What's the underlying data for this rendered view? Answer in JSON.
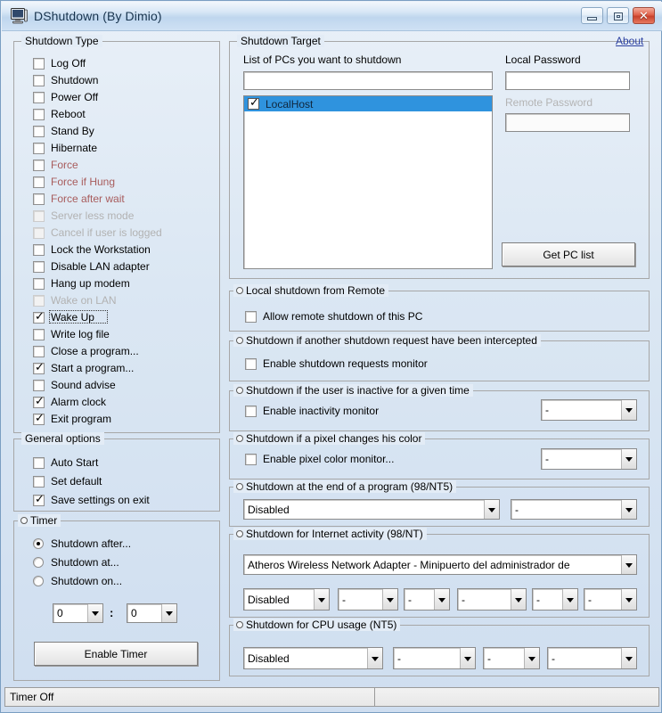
{
  "window": {
    "title": "DShutdown (By Dimio)",
    "icon": "computer-icon",
    "minimize_label": "",
    "maximize_label": "",
    "close_label": "✕"
  },
  "shutdown_type": {
    "title": "Shutdown Type",
    "items": [
      {
        "label": "Log Off",
        "checked": false,
        "state": "normal"
      },
      {
        "label": "Shutdown",
        "checked": false,
        "state": "normal"
      },
      {
        "label": "Power Off",
        "checked": false,
        "state": "normal"
      },
      {
        "label": "Reboot",
        "checked": false,
        "state": "normal"
      },
      {
        "label": "Stand By",
        "checked": false,
        "state": "normal"
      },
      {
        "label": "Hibernate",
        "checked": false,
        "state": "normal"
      },
      {
        "label": "Force",
        "checked": false,
        "state": "red"
      },
      {
        "label": "Force if Hung",
        "checked": false,
        "state": "red"
      },
      {
        "label": "Force after wait",
        "checked": false,
        "state": "red"
      },
      {
        "label": "Server less mode",
        "checked": false,
        "state": "disabled"
      },
      {
        "label": "Cancel if user is logged",
        "checked": false,
        "state": "disabled"
      },
      {
        "label": "Lock the Workstation",
        "checked": false,
        "state": "normal"
      },
      {
        "label": "Disable LAN adapter",
        "checked": false,
        "state": "normal"
      },
      {
        "label": "Hang up modem",
        "checked": false,
        "state": "normal"
      },
      {
        "label": "Wake on LAN",
        "checked": false,
        "state": "disabled"
      },
      {
        "label": "Wake Up",
        "checked": true,
        "state": "focused"
      },
      {
        "label": "Write log file",
        "checked": false,
        "state": "normal"
      },
      {
        "label": "Close a program...",
        "checked": false,
        "state": "normal"
      },
      {
        "label": "Start a program...",
        "checked": true,
        "state": "normal"
      },
      {
        "label": "Sound advise",
        "checked": false,
        "state": "normal"
      },
      {
        "label": "Alarm clock",
        "checked": true,
        "state": "normal"
      },
      {
        "label": "Exit program",
        "checked": true,
        "state": "normal"
      }
    ]
  },
  "general_options": {
    "title": "General options",
    "items": [
      {
        "label": "Auto Start",
        "checked": false
      },
      {
        "label": "Set default",
        "checked": false
      },
      {
        "label": "Save settings on exit",
        "checked": true
      }
    ]
  },
  "timer": {
    "title": "Timer",
    "modes": [
      {
        "label": "Shutdown after...",
        "selected": true
      },
      {
        "label": "Shutdown at...",
        "selected": false
      },
      {
        "label": "Shutdown on...",
        "selected": false
      }
    ],
    "hours": "0",
    "separator": ":",
    "minutes": "0",
    "enable_button": "Enable Timer"
  },
  "shutdown_target": {
    "title": "Shutdown Target",
    "about_link": "About",
    "pc_list_label": "List of PCs you want to shutdown",
    "pc_filter_value": "",
    "pc_list": [
      {
        "name": "LocalHost",
        "checked": true,
        "selected": true
      }
    ],
    "local_password_label": "Local Password",
    "local_password_value": "",
    "remote_password_label": "Remote Password",
    "remote_password_value": "",
    "remote_password_disabled": true,
    "get_pc_list_button": "Get PC list"
  },
  "local_remote": {
    "title": "Local shutdown from Remote",
    "checkbox_label": "Allow remote shutdown of this PC",
    "checked": false
  },
  "intercepted": {
    "title": "Shutdown if another shutdown request have been intercepted",
    "checkbox_label": "Enable shutdown requests monitor",
    "checked": false
  },
  "inactivity": {
    "title": "Shutdown if the user is inactive for a given time",
    "checkbox_label": "Enable inactivity monitor",
    "checked": false,
    "combo_value": "-"
  },
  "pixel_color": {
    "title": "Shutdown if a pixel changes his color",
    "checkbox_label": "Enable pixel color monitor...",
    "checked": false,
    "combo_value": "-"
  },
  "end_of_program": {
    "title": "Shutdown at the end of a program (98/NT5)",
    "combo1_value": "Disabled",
    "combo2_value": "-"
  },
  "internet_activity": {
    "title": "Shutdown for Internet activity (98/NT)",
    "adapter_value": "Atheros Wireless Network Adapter - Minipuerto del administrador de",
    "combos": [
      "Disabled",
      "-",
      "-",
      "-",
      "-",
      "-"
    ]
  },
  "cpu_usage": {
    "title": "Shutdown for CPU usage (NT5)",
    "combos": [
      "Disabled",
      "-",
      "-",
      "-"
    ]
  },
  "statusbar": {
    "text": "Timer Off"
  },
  "colors": {
    "accent_selection": "#2f93de",
    "force_text": "#a85c5c",
    "disabled_text": "#b2b2b2",
    "link": "#2a3fa0",
    "titlebar": "#bfd6ee"
  }
}
